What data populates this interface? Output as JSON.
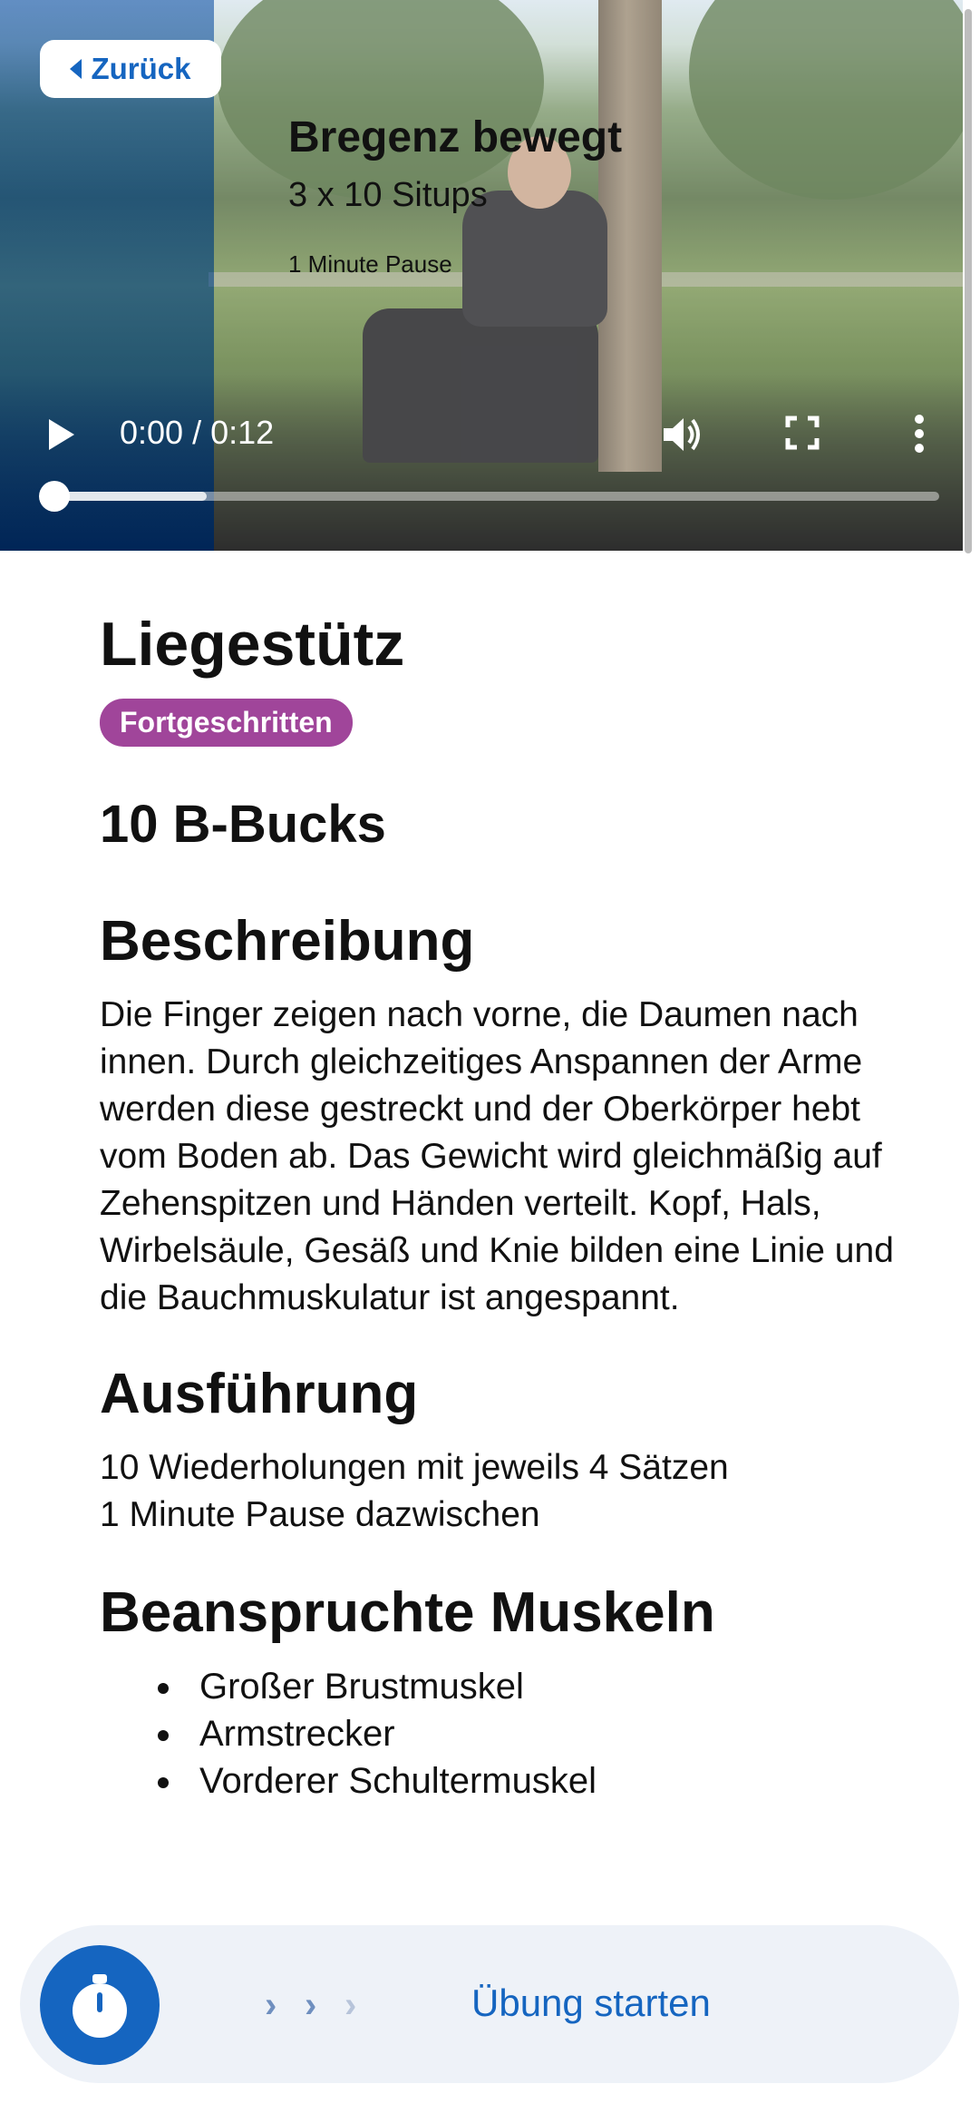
{
  "video": {
    "back_label": "Zurück",
    "overlay_title": "Bregenz bewegt",
    "overlay_subtitle": "3 x 10 Situps",
    "overlay_pause": "1 Minute Pause",
    "time": "0:00 / 0:12",
    "progress": 0.0
  },
  "exercise": {
    "title": "Liegestütz",
    "level": "Fortgeschritten",
    "level_color": "#a0459a",
    "reward": "10 B-Bucks"
  },
  "description": {
    "heading": "Beschreibung",
    "text": "Die Finger zeigen nach vorne, die Daumen nach innen. Durch gleichzeitiges Anspannen der Arme werden diese gestreckt und der Oberkörper hebt vom Boden ab. Das Gewicht wird gleichmäßig auf Zehenspitzen und Händen verteilt. Kopf, Hals, Wirbelsäule, Gesäß und Knie bilden eine Linie und die Bauchmuskulatur ist angespannt."
  },
  "execution": {
    "heading": "Ausführung",
    "line1": "10 Wiederholungen mit jeweils 4 Sätzen",
    "line2": "1 Minute Pause dazwischen"
  },
  "muscles": {
    "heading": "Beanspruchte Muskeln",
    "items": [
      "Großer Brustmuskel",
      "Armstrecker",
      "Vorderer Schultermuskel"
    ]
  },
  "bottom_bar": {
    "start_label": "Übung starten",
    "accent": "#1565c0",
    "icon": "stopwatch-icon"
  }
}
